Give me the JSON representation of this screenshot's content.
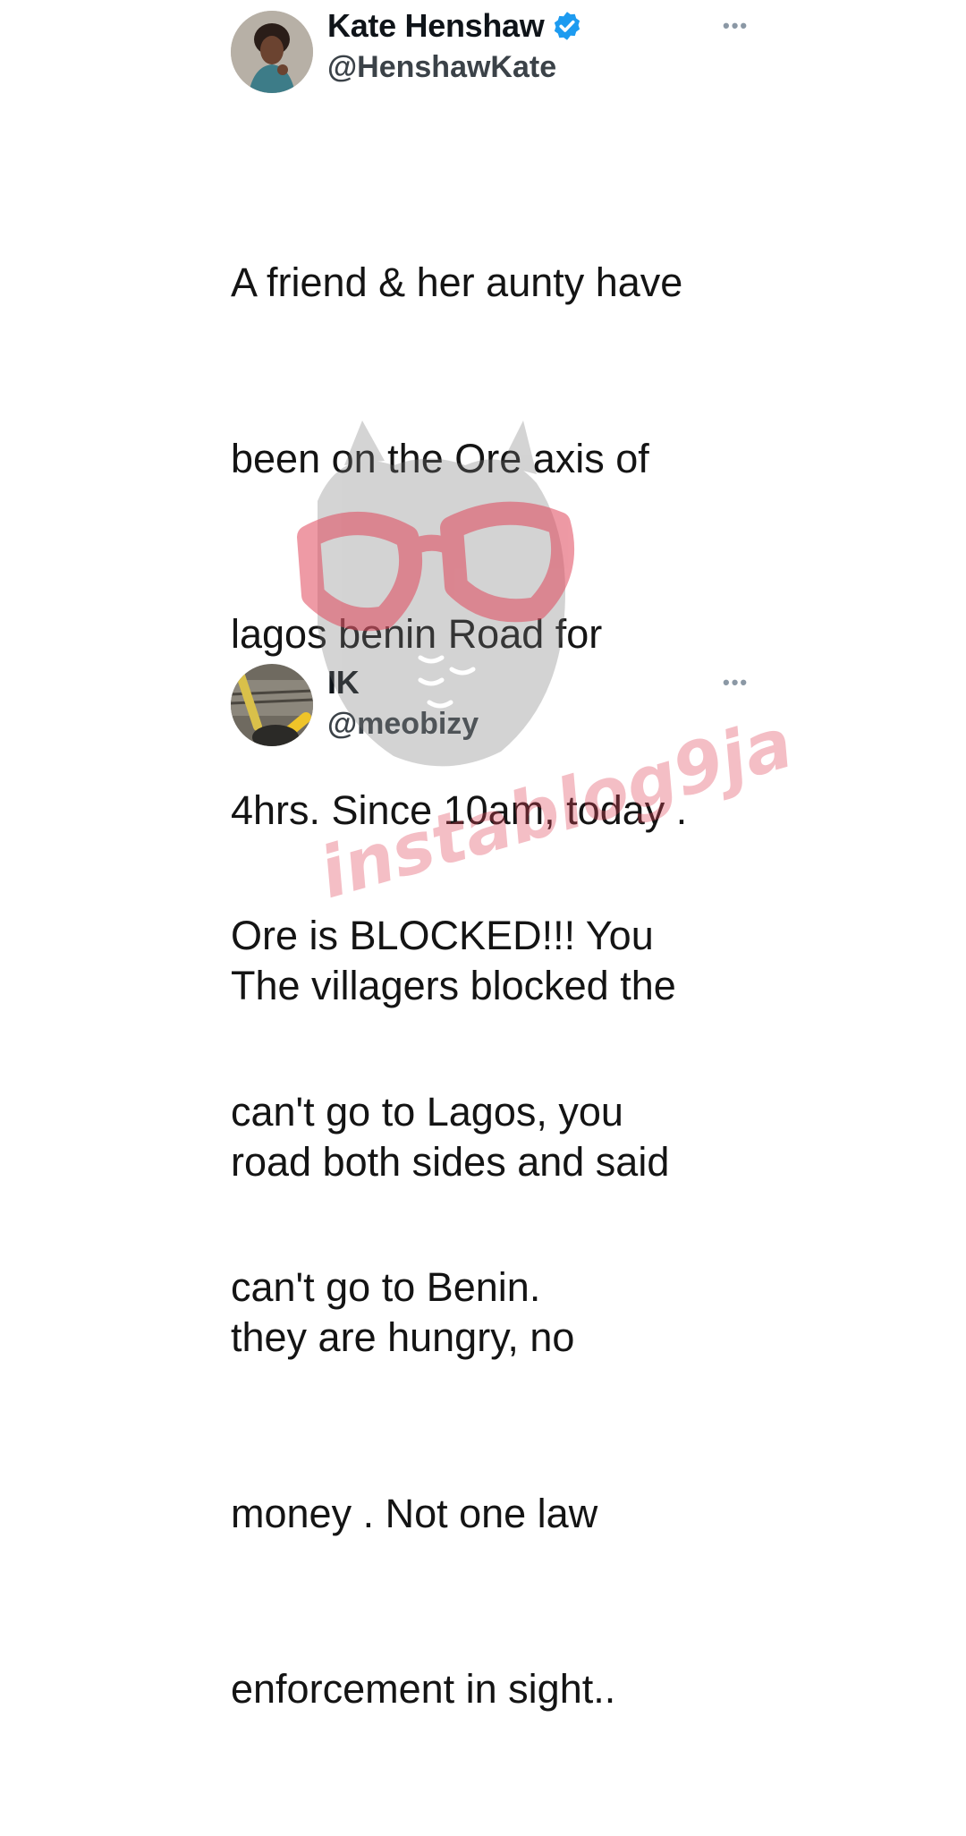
{
  "tweets": [
    {
      "name": "Kate Henshaw",
      "handle": "@HenshawKate",
      "verified": true,
      "more_icon": "more-horizontal-icon",
      "lines": [
        "A friend & her aunty have",
        "been on the Ore axis of",
        "lagos benin Road for",
        "4hrs. Since 10am, today .",
        "The villagers blocked the",
        "road both sides and said",
        "they are hungry, no",
        "money . Not one law",
        "enforcement in sight.."
      ]
    },
    {
      "name": "IK",
      "handle": "@meobizy",
      "verified": false,
      "more_icon": "more-horizontal-icon",
      "lines": [
        "Ore is BLOCKED!!! You",
        "can't go to Lagos, you",
        "can't go to Benin."
      ]
    }
  ],
  "watermark": {
    "text": "instablog9ja",
    "icon": "owl-with-glasses-icon",
    "color": "#e0475b"
  },
  "colors": {
    "verified": "#1d9bf0",
    "text": "#141414"
  }
}
